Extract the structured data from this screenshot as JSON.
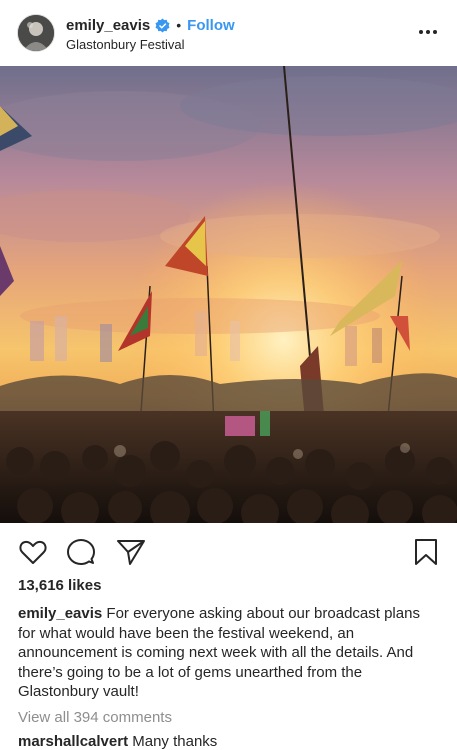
{
  "post": {
    "username": "emily_eavis",
    "verified": true,
    "separator": "•",
    "follow_label": "Follow",
    "location": "Glastonbury Festival",
    "more_icon": "more-horizontal-icon",
    "photo_subject": "festival-crowd-flags-sunset",
    "colors": {
      "accent": "#3897f0",
      "text": "#262626",
      "muted": "#8e8e8e"
    }
  },
  "actions": {
    "like_icon": "heart-icon",
    "comment_icon": "comment-icon",
    "share_icon": "paper-plane-icon",
    "save_icon": "bookmark-icon"
  },
  "likes_label": "13,616 likes",
  "caption": {
    "username": "emily_eavis",
    "text": "For everyone asking about our broadcast plans for what would have been the festival weekend, an announcement is coming next week with all the details. And there’s going to be a lot of gems unearthed from the Glastonbury vault!"
  },
  "view_all_comments": "View all 394 comments",
  "comments": [
    {
      "username": "marshallcalvert",
      "text": "Many thanks"
    }
  ]
}
